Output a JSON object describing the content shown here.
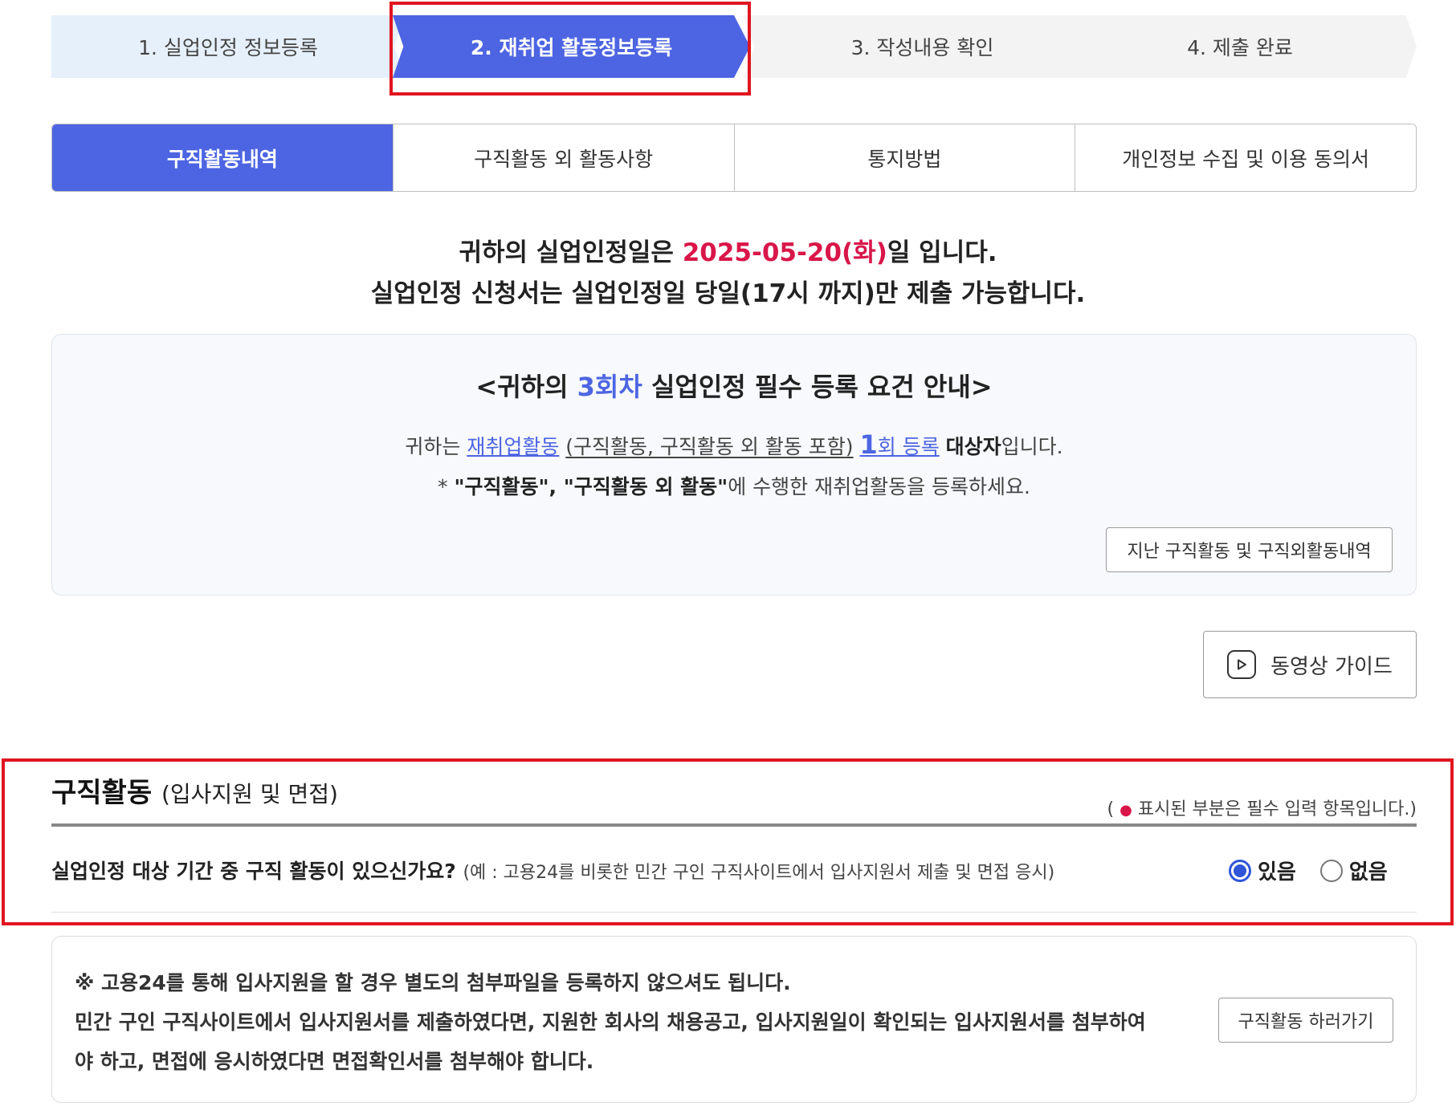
{
  "steps": [
    {
      "label": "1. 실업인정 정보등록"
    },
    {
      "label": "2. 재취업 활동정보등록"
    },
    {
      "label": "3. 작성내용 확인"
    },
    {
      "label": "4. 제출 완료"
    }
  ],
  "tabs": [
    {
      "label": "구직활동내역"
    },
    {
      "label": "구직활동 외 활동사항"
    },
    {
      "label": "통지방법"
    },
    {
      "label": "개인정보 수집 및 이용 동의서"
    }
  ],
  "notice": {
    "line1_prefix": "귀하의 실업인정일은 ",
    "date": "2025-05-20(화)",
    "line1_suffix": "일 입니다.",
    "line2": "실업인정 신청서는 실업인정일 당일(17시 까지)만 제출 가능합니다."
  },
  "requirement": {
    "title_prefix": "<귀하의 ",
    "round": "3회차",
    "title_suffix": " 실업인정 필수 등록 요건 안내>",
    "line1_prefix": "귀하는 ",
    "activity_link": "재취업활동",
    "paren": "(구직활동, 구직활동 외 활동 포함)",
    "count_num": "1",
    "count_text": "회 등록",
    "target": "대상자",
    "line1_suffix": "입니다.",
    "line2_star": "* ",
    "line2_b1": "\"구직활동\", \"구직활동 외 활동\"",
    "line2_rest": "에 수행한 재취업활동을 등록하세요.",
    "past_button": "지난 구직활동 및 구직외활동내역"
  },
  "video_button": "동영상 가이드",
  "job_section": {
    "title": "구직활동",
    "subtitle": "(입사지원 및 면접)",
    "req_note_open": "( ",
    "req_note_dot": "●",
    "req_note_text": " 표시된 부분은 필수 입력 항목입니다.)",
    "question": "실업인정 대상 기간 중 구직 활동이 있으신가요?",
    "question_example": "(예 : 고용24를 비롯한 민간 구인 구직사이트에서 입사지원서 제출 및 면접 응시)",
    "options": [
      {
        "label": "있음",
        "selected": true
      },
      {
        "label": "없음",
        "selected": false
      }
    ]
  },
  "info": {
    "line1": "※ 고용24를 통해 입사지원을 할 경우 별도의 첨부파일을 등록하지 않으셔도 됩니다.",
    "line2": "민간 구인 구직사이트에서 입사지원서를 제출하였다면, 지원한 회사의 채용공고, 입사지원일이 확인되는 입사지원서를 첨부하여",
    "line3": "야 하고, 면접에 응시하였다면 면접확인서를 첨부해야 합니다.",
    "go_button": "구직활동 하러가기"
  },
  "colors": {
    "accent": "#4d65e2",
    "date_red": "#d9164a",
    "highlight_red": "#e0151f"
  }
}
